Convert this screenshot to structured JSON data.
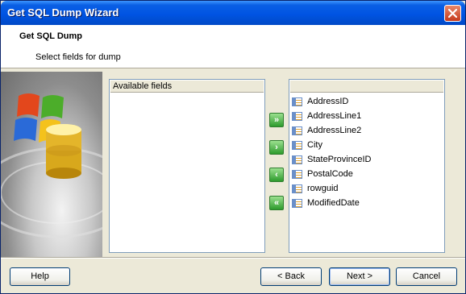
{
  "window": {
    "title": "Get SQL Dump Wizard"
  },
  "header": {
    "title": "Get SQL Dump",
    "subtitle": "Select fields for dump"
  },
  "available": {
    "header": "Available fields",
    "items": []
  },
  "selected": {
    "header": "",
    "items": [
      {
        "label": "AddressID",
        "icon": "field-icon"
      },
      {
        "label": "AddressLine1",
        "icon": "field-icon"
      },
      {
        "label": "AddressLine2",
        "icon": "field-icon"
      },
      {
        "label": "City",
        "icon": "field-icon"
      },
      {
        "label": "StateProvinceID",
        "icon": "field-icon"
      },
      {
        "label": "PostalCode",
        "icon": "field-icon"
      },
      {
        "label": "rowguid",
        "icon": "field-icon"
      },
      {
        "label": "ModifiedDate",
        "icon": "field-icon"
      }
    ]
  },
  "arrows": {
    "add_all": "»",
    "add": "›",
    "remove": "‹",
    "remove_all": "«"
  },
  "buttons": {
    "help": "Help",
    "back": "< Back",
    "next": "Next >",
    "cancel": "Cancel"
  },
  "colors": {
    "title_bar": "#0054e3",
    "arrow_green": "#2d9b2d",
    "dialog_bg": "#ece9d8"
  }
}
